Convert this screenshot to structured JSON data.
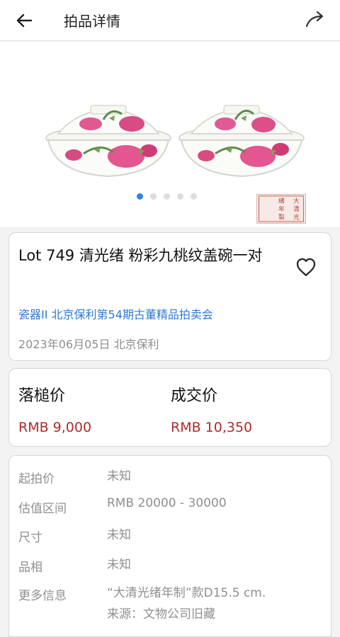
{
  "header": {
    "title": "拍品详情",
    "back_icon": "arrow-left-icon",
    "share_icon": "share-arrow-icon"
  },
  "gallery": {
    "image_count": 5,
    "active_index": 0,
    "seal_text": "大清光緒年製",
    "accent_color": "#2d84e6"
  },
  "lot": {
    "title": "Lot 749 清光绪 粉彩九桃纹盖碗一对",
    "sale_name": "瓷器II 北京保利第54期古董精品拍卖会",
    "date_house": "2023年06月05日 北京保利"
  },
  "prices": {
    "hammer_label": "落槌价",
    "hammer_value": "RMB 9,000",
    "final_label": "成交价",
    "final_value": "RMB 10,350",
    "price_color": "#b32a2a"
  },
  "details": [
    {
      "label": "起拍价",
      "value": "未知"
    },
    {
      "label": "估值区间",
      "value": "RMB 20000 - 30000"
    },
    {
      "label": "尺寸",
      "value": "未知"
    },
    {
      "label": "品相",
      "value": "未知"
    },
    {
      "label": "更多信息",
      "value": "“大清光绪年制”款D15.5 cm.",
      "value2": "来源：文物公司旧藏"
    }
  ]
}
